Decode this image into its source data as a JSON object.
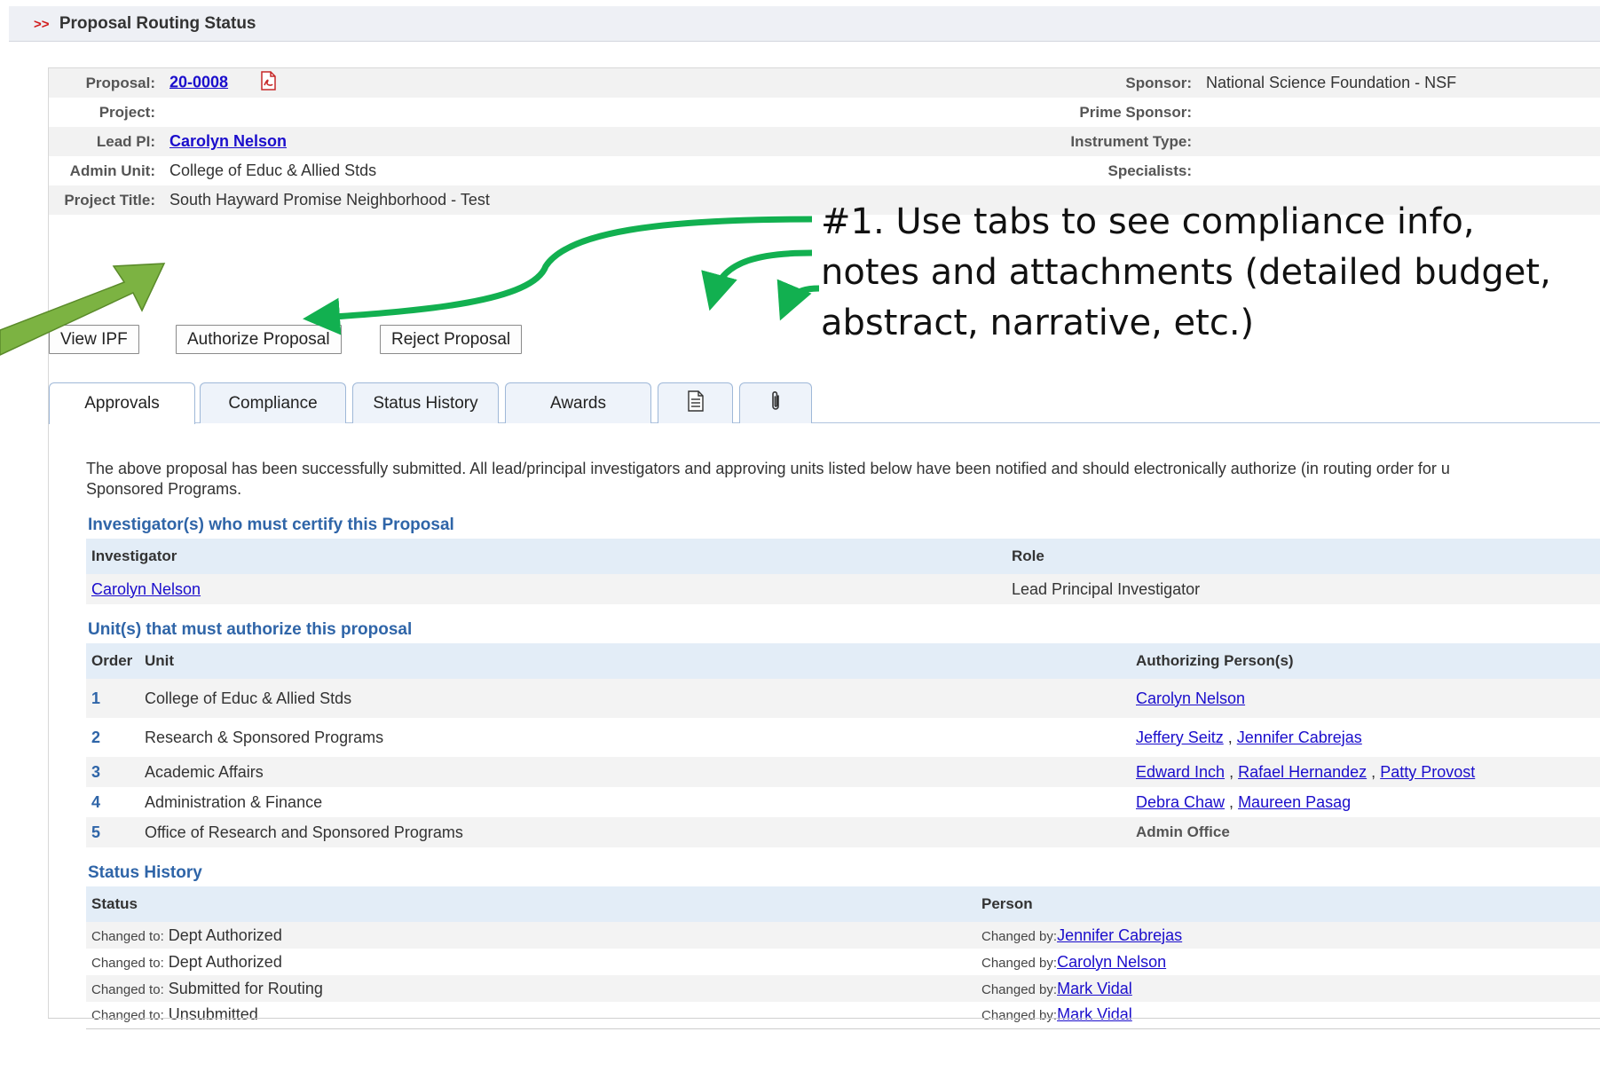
{
  "header": {
    "prefix": ">>",
    "title": "Proposal Routing Status"
  },
  "info": {
    "proposal_label": "Proposal:",
    "proposal_value": "20-0008",
    "project_label": "Project:",
    "project_value": "",
    "lead_pi_label": "Lead PI:",
    "lead_pi_value": "Carolyn Nelson",
    "admin_unit_label": "Admin Unit:",
    "admin_unit_value": "College of Educ & Allied Stds",
    "project_title_label": "Project Title:",
    "project_title_value": "South Hayward Promise Neighborhood - Test",
    "sponsor_label": "Sponsor:",
    "sponsor_value": "National Science Foundation - NSF",
    "prime_sponsor_label": "Prime Sponsor:",
    "instrument_type_label": "Instrument Type:",
    "specialists_label": "Specialists:"
  },
  "buttons": {
    "view_ipf": "View IPF",
    "authorize": "Authorize Proposal",
    "reject": "Reject Proposal"
  },
  "tabs": [
    {
      "label": "Approvals"
    },
    {
      "label": "Compliance"
    },
    {
      "label": "Status History"
    },
    {
      "label": "Awards"
    },
    {
      "label": "notes-icon"
    },
    {
      "label": "paperclip-icon"
    }
  ],
  "intro": "The above proposal has been successfully submitted. All lead/principal investigators and approving units listed below have been notified and should electronically authorize (in routing order for u",
  "intro2": "Sponsored Programs.",
  "investigators": {
    "title": "Investigator(s) who must certify this Proposal",
    "col_investigator": "Investigator",
    "col_role": "Role",
    "rows": [
      {
        "name": "Carolyn Nelson",
        "role": "Lead Principal Investigator"
      }
    ]
  },
  "units": {
    "title": "Unit(s) that must authorize this proposal",
    "col_order": "Order",
    "col_unit": "Unit",
    "col_persons": "Authorizing Person(s)",
    "rows": [
      {
        "order": "1",
        "unit": "College of Educ & Allied Stds",
        "persons": [
          "Carolyn Nelson"
        ]
      },
      {
        "order": "2",
        "unit": "Research & Sponsored Programs",
        "persons": [
          "Jeffery Seitz",
          "Jennifer Cabrejas"
        ]
      },
      {
        "order": "3",
        "unit": "Academic Affairs",
        "persons": [
          "Edward Inch",
          "Rafael Hernandez",
          "Patty Provost"
        ]
      },
      {
        "order": "4",
        "unit": "Administration & Finance",
        "persons": [
          "Debra Chaw",
          "Maureen Pasag"
        ]
      },
      {
        "order": "5",
        "unit": "Office of Research and Sponsored Programs",
        "persons": [],
        "text": "Admin Office"
      }
    ]
  },
  "status_history": {
    "title": "Status History",
    "col_status": "Status",
    "col_person": "Person",
    "changed_to": "Changed to:",
    "changed_by": "Changed by:",
    "rows": [
      {
        "status": "Dept Authorized",
        "person": "Jennifer Cabrejas"
      },
      {
        "status": "Dept Authorized",
        "person": "Carolyn Nelson"
      },
      {
        "status": "Submitted for Routing",
        "person": "Mark Vidal"
      },
      {
        "status": "Unsubmitted",
        "person": "Mark Vidal"
      }
    ]
  },
  "annotation": {
    "line1": "#1. Use tabs to see compliance info,",
    "line2": "notes and attachments (detailed budget,",
    "line3": "abstract, narrative, etc.)"
  },
  "colors": {
    "accent": "#2f65a8",
    "link": "#1a0dcc",
    "arrow_green": "#12b050",
    "arrow_olive": "#7cb342"
  }
}
